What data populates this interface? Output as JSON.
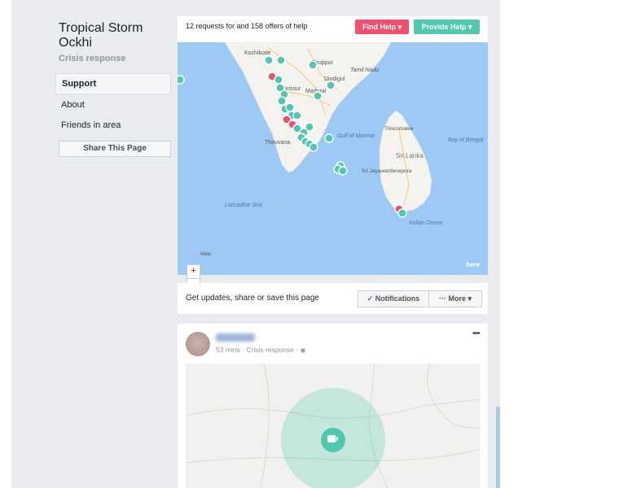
{
  "page": {
    "title": "Tropical Storm Ockhi",
    "subtitle": "Crisis response"
  },
  "sidebar": {
    "items": [
      {
        "label": "Support"
      },
      {
        "label": "About"
      },
      {
        "label": "Friends in area"
      }
    ],
    "share_label": "Share This Page"
  },
  "summary": {
    "text": "12 requests for and 158 offers of help",
    "find_help_label": "Find Help",
    "provide_help_label": "Provide Help"
  },
  "map": {
    "labels": {
      "kozhikode": "Kozhikode",
      "tiruppur": "Tiruppur",
      "thrissur": "Thrissur",
      "dindigul": "Dindigul",
      "madurai": "Madurai",
      "tamil_nadu": "Tamil Nadu",
      "thiruvananthapuram": "Thiruvana",
      "gulf_of_mannar": "Gulf of Mannar",
      "trincomalee": "Trincomalee",
      "sri_lanka": "Sri Lanka",
      "sri_jayawardenepura": "Sri Jayawardenepura",
      "bay_of_bengal": "Bay of Bengal",
      "laccadive_sea": "Laccadive Sea",
      "indian_ocean": "Indian Ocean",
      "male": "Male",
      "here": "here"
    },
    "zoom_in": "+",
    "zoom_out": "−",
    "colors": {
      "water": "#9ccaf5",
      "land": "#f4f3ef",
      "offer": "#4ec8ae",
      "request": "#f0506e"
    }
  },
  "updates": {
    "text": "Get updates, share or save this page",
    "notifications_label": "Notifications",
    "more_label": "More"
  },
  "post": {
    "time": "53 mins",
    "category": "Crisis response",
    "separator": "·",
    "more_icon": "ellipsis-icon"
  }
}
